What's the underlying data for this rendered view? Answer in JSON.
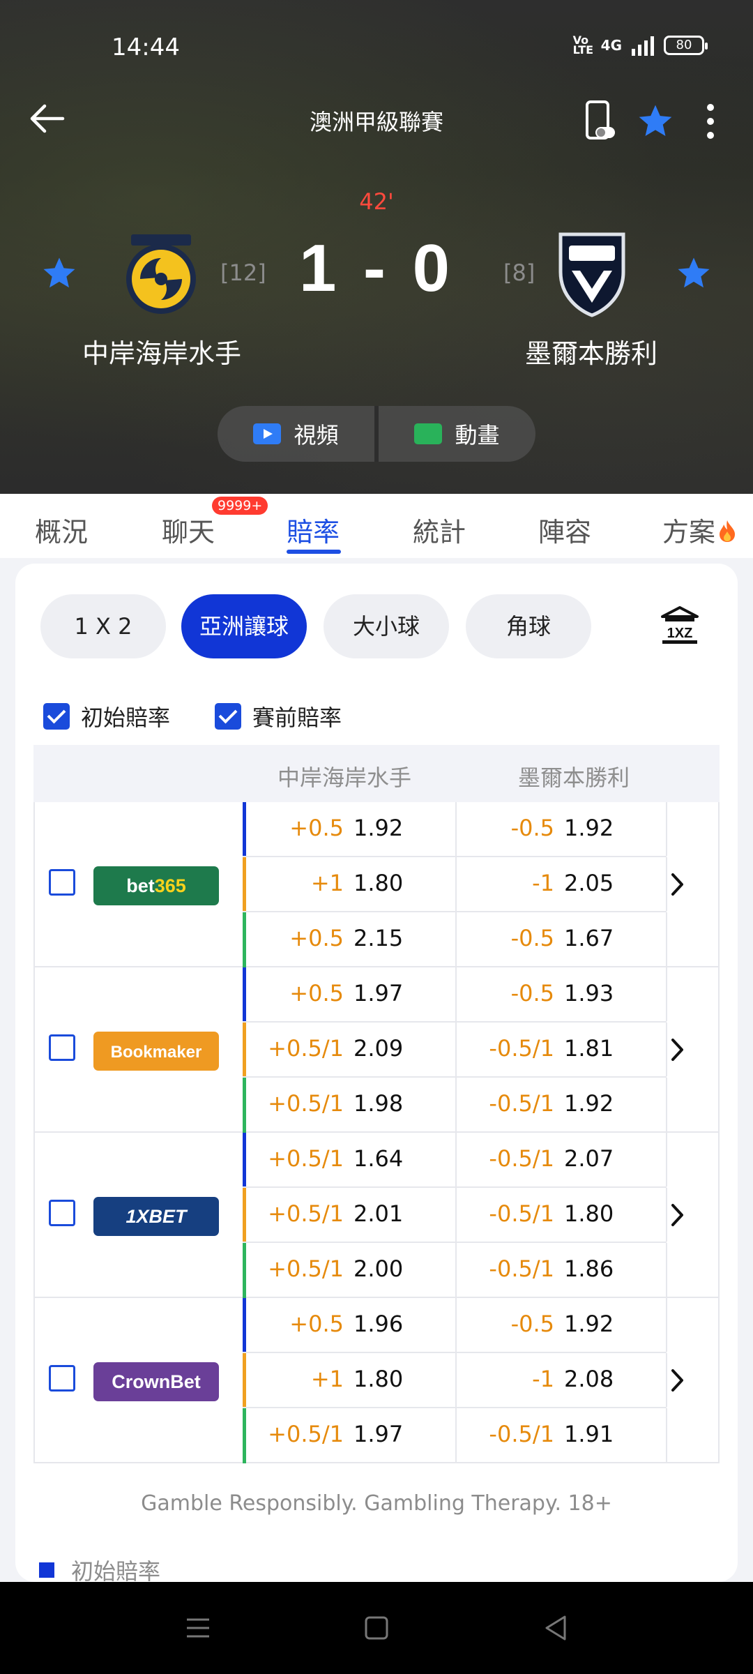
{
  "status_bar": {
    "time": "14:44",
    "network": "4G",
    "volte": "Vo LTE",
    "battery": "80"
  },
  "header": {
    "league": "澳洲甲級聯賽",
    "minute": "42'",
    "score": "1 - 0"
  },
  "home": {
    "name": "中岸海岸水手",
    "rank": "[12]"
  },
  "away": {
    "name": "墨爾本勝利",
    "rank": "[8]"
  },
  "media": {
    "video": "視頻",
    "animation": "動畫"
  },
  "tabs": [
    {
      "label": "概況"
    },
    {
      "label": "聊天",
      "badge": "9999+"
    },
    {
      "label": "賠率"
    },
    {
      "label": "統計"
    },
    {
      "label": "陣容"
    },
    {
      "label": "方案"
    }
  ],
  "markets": [
    "1 X 2",
    "亞洲讓球",
    "大小球",
    "角球"
  ],
  "checks": {
    "initial": "初始賠率",
    "prematch": "賽前賠率"
  },
  "table_header": {
    "home": "中岸海岸水手",
    "away": "墨爾本勝利"
  },
  "colors": {
    "initial": "#1136d6",
    "prematch": "#f0a020",
    "live": "#2db55d",
    "handicap": "#e68a0c"
  },
  "bookmakers": [
    {
      "name": "bet365",
      "rows": [
        {
          "h_hdp": "+0.5",
          "h_odd": "1.92",
          "a_hdp": "-0.5",
          "a_odd": "1.92"
        },
        {
          "h_hdp": "+1",
          "h_odd": "1.80",
          "a_hdp": "-1",
          "a_odd": "2.05"
        },
        {
          "h_hdp": "+0.5",
          "h_odd": "2.15",
          "a_hdp": "-0.5",
          "a_odd": "1.67"
        }
      ]
    },
    {
      "name": "Bookmaker",
      "rows": [
        {
          "h_hdp": "+0.5",
          "h_odd": "1.97",
          "a_hdp": "-0.5",
          "a_odd": "1.93"
        },
        {
          "h_hdp": "+0.5/1",
          "h_odd": "2.09",
          "a_hdp": "-0.5/1",
          "a_odd": "1.81"
        },
        {
          "h_hdp": "+0.5/1",
          "h_odd": "1.98",
          "a_hdp": "-0.5/1",
          "a_odd": "1.92"
        }
      ]
    },
    {
      "name": "1XBET",
      "rows": [
        {
          "h_hdp": "+0.5/1",
          "h_odd": "1.64",
          "a_hdp": "-0.5/1",
          "a_odd": "2.07"
        },
        {
          "h_hdp": "+0.5/1",
          "h_odd": "2.01",
          "a_hdp": "-0.5/1",
          "a_odd": "1.80"
        },
        {
          "h_hdp": "+0.5/1",
          "h_odd": "2.00",
          "a_hdp": "-0.5/1",
          "a_odd": "1.86"
        }
      ]
    },
    {
      "name": "CrownBet",
      "rows": [
        {
          "h_hdp": "+0.5",
          "h_odd": "1.96",
          "a_hdp": "-0.5",
          "a_odd": "1.92"
        },
        {
          "h_hdp": "+1",
          "h_odd": "1.80",
          "a_hdp": "-1",
          "a_odd": "2.08"
        },
        {
          "h_hdp": "+0.5/1",
          "h_odd": "1.97",
          "a_hdp": "-0.5/1",
          "a_odd": "1.91"
        }
      ]
    }
  ],
  "footer": {
    "gamble": "Gamble Responsibly. Gambling Therapy. 18+",
    "legend_initial": "初始賠率"
  }
}
